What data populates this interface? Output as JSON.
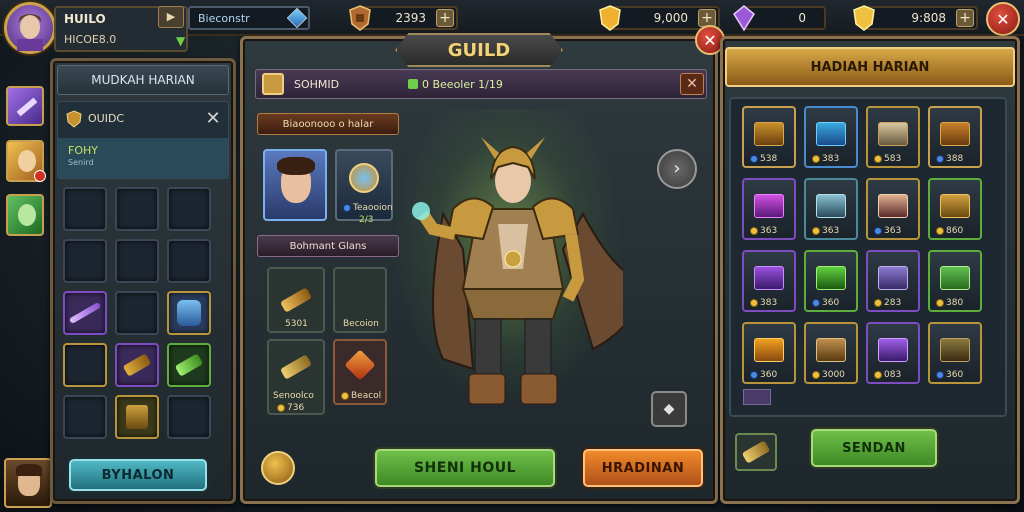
{
  "player": {
    "name": "HUILO",
    "sub": "HICOE8.0",
    "id_field": "Bieconstr"
  },
  "resources": [
    {
      "name": "wood",
      "value": "2393",
      "color": "#c08040"
    },
    {
      "name": "gold",
      "value": "9,000",
      "color": "#f0c040"
    },
    {
      "name": "gems",
      "value": "0",
      "color": "#9a5ad8"
    },
    {
      "name": "coins",
      "value": "9:808",
      "color": "#f0c040"
    }
  ],
  "left_panel": {
    "title": "MUDKAH HARIAN",
    "sub_title": "OUIDC",
    "member_name": "FOHY",
    "member_role": "Senird",
    "button": "BYHALON"
  },
  "guild": {
    "title": "GUILD",
    "header_name": "SOHMID",
    "header_info": "0 Beeoler 1/19",
    "section1": "Biaoonooo o halar",
    "item_label": "Teaooion",
    "item_count": "2/3",
    "section2": "Bohmant Glans",
    "cards": [
      {
        "label": "5301"
      },
      {
        "label": "Becoion"
      },
      {
        "label": "Senoolco",
        "sub": "736"
      },
      {
        "label": "Beacol"
      }
    ],
    "btn_share": "SHENI HOUL",
    "btn_harvest": "HRADINAN"
  },
  "right_panel": {
    "title": "HADIAH HARIAN",
    "rewards": [
      {
        "label": "538"
      },
      {
        "label": "383"
      },
      {
        "label": "583"
      },
      {
        "label": "388"
      },
      {
        "label": "363"
      },
      {
        "label": "363"
      },
      {
        "label": "363"
      },
      {
        "label": "860"
      },
      {
        "label": "383"
      },
      {
        "label": "360"
      },
      {
        "label": "283"
      },
      {
        "label": "380"
      },
      {
        "label": "360"
      },
      {
        "label": "3000"
      },
      {
        "label": "083"
      },
      {
        "label": "360"
      }
    ],
    "button": "SENDAN"
  }
}
